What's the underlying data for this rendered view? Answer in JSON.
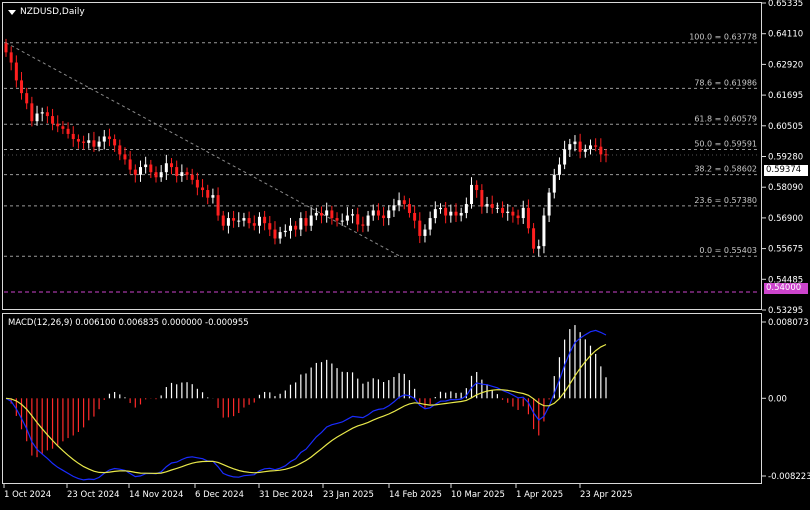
{
  "chart_title": "NZDUSD,Daily",
  "macd_label": "MACD(12,26,9) 0.006100 0.006835 0.000000 -0.000955",
  "price_axis_labels": [
    "0.65335",
    "0.64110",
    "0.62920",
    "0.61695",
    "0.60505",
    "0.59280",
    "0.58090",
    "0.56900",
    "0.55675",
    "0.54485",
    "0.53295"
  ],
  "macd_axis_labels": [
    "0.008073",
    "0.00",
    "-0.008223"
  ],
  "current_price": "0.59374",
  "marked_level": "0.54000",
  "date_labels": [
    "1 Oct 2024",
    "23 Oct 2024",
    "14 Nov 2024",
    "6 Dec 2024",
    "31 Dec 2024",
    "23 Jan 2025",
    "14 Feb 2025",
    "10 Mar 2025",
    "1 Apr 2025",
    "23 Apr 2025"
  ],
  "fib_levels": [
    {
      "label": "100.0 = 0.63778",
      "value": 0.63778
    },
    {
      "label": "78.6 = 0.61986",
      "value": 0.61986
    },
    {
      "label": "61.8 = 0.60579",
      "value": 0.60579
    },
    {
      "label": "50.0 = 0.59591",
      "value": 0.59591
    },
    {
      "label": "38.2 = 0.58602",
      "value": 0.58602
    },
    {
      "label": "23.6 = 0.57380",
      "value": 0.5738
    },
    {
      "label": "0.0 = 0.55403",
      "value": 0.55403
    }
  ],
  "colors": {
    "bull": "#ffffff",
    "bear": "#ff1f1f",
    "signal": "#e8e84a",
    "macd_line": "#1a2cff",
    "level": "#cc44cc",
    "fib": "#9a9a9a"
  },
  "chart_data": {
    "type": "candlestick",
    "title": "NZDUSD,Daily",
    "ylim": [
      0.53295,
      0.65335
    ],
    "close": [
      0.634,
      0.63,
      0.623,
      0.618,
      0.614,
      0.607,
      0.61,
      0.6105,
      0.609,
      0.606,
      0.605,
      0.604,
      0.602,
      0.6,
      0.599,
      0.5985,
      0.5995,
      0.597,
      0.599,
      0.601,
      0.6,
      0.5975,
      0.594,
      0.592,
      0.588,
      0.586,
      0.589,
      0.59,
      0.587,
      0.585,
      0.587,
      0.5905,
      0.589,
      0.5855,
      0.587,
      0.586,
      0.584,
      0.581,
      0.58,
      0.577,
      0.578,
      0.57,
      0.566,
      0.569,
      0.568,
      0.568,
      0.569,
      0.567,
      0.566,
      0.5695,
      0.567,
      0.5645,
      0.561,
      0.5635,
      0.564,
      0.566,
      0.5645,
      0.569,
      0.566,
      0.57,
      0.571,
      0.57,
      0.572,
      0.569,
      0.568,
      0.568,
      0.57,
      0.5705,
      0.5665,
      0.566,
      0.57,
      0.572,
      0.57,
      0.569,
      0.572,
      0.574,
      0.576,
      0.5745,
      0.571,
      0.568,
      0.562,
      0.5645,
      0.569,
      0.5725,
      0.573,
      0.57,
      0.5715,
      0.57,
      0.571,
      0.5745,
      0.582,
      0.58,
      0.5735,
      0.5745,
      0.573,
      0.573,
      0.571,
      0.5715,
      0.57,
      0.569,
      0.573,
      0.565,
      0.557,
      0.558,
      0.57,
      0.579,
      0.586,
      0.59,
      0.596,
      0.598,
      0.599,
      0.595,
      0.596,
      0.5975,
      0.597,
      0.594,
      0.5937
    ],
    "macd_histogram_range": [
      -0.008223,
      0.008073
    ]
  }
}
